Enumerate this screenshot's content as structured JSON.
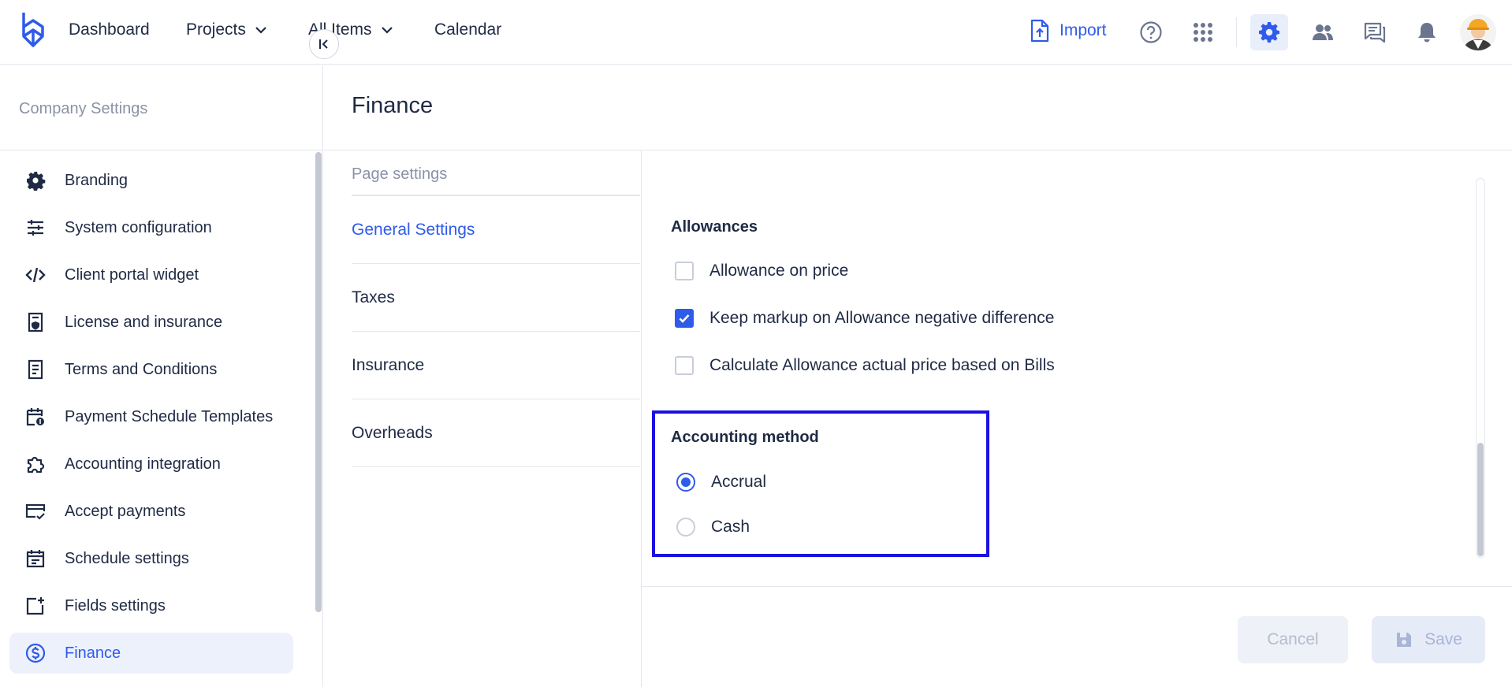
{
  "topbar": {
    "nav": [
      {
        "label": "Dashboard",
        "has_dropdown": false
      },
      {
        "label": "Projects",
        "has_dropdown": true
      },
      {
        "label": "All Items",
        "has_dropdown": true
      },
      {
        "label": "Calendar",
        "has_dropdown": false
      }
    ],
    "import_label": "Import",
    "icons": [
      "help-icon",
      "apps-grid-icon",
      "settings-icon",
      "users-icon",
      "chat-icon",
      "bell-icon"
    ],
    "active_icon": "settings-icon"
  },
  "sidebar": {
    "title": "Company Settings",
    "items": [
      {
        "label": "Branding",
        "icon": "gear-icon"
      },
      {
        "label": "System configuration",
        "icon": "sliders-icon"
      },
      {
        "label": "Client portal widget",
        "icon": "code-icon"
      },
      {
        "label": "License and insurance",
        "icon": "license-icon"
      },
      {
        "label": "Terms and Conditions",
        "icon": "document-icon"
      },
      {
        "label": "Payment Schedule Templates",
        "icon": "calendar-money-icon"
      },
      {
        "label": "Accounting integration",
        "icon": "puzzle-icon"
      },
      {
        "label": "Accept payments",
        "icon": "card-check-icon"
      },
      {
        "label": "Schedule settings",
        "icon": "calendar-icon"
      },
      {
        "label": "Fields settings",
        "icon": "add-field-icon"
      },
      {
        "label": "Finance",
        "icon": "dollar-circle-icon",
        "active": true
      }
    ]
  },
  "page": {
    "title": "Finance"
  },
  "subnav": {
    "heading": "Page settings",
    "items": [
      {
        "label": "General Settings",
        "active": true
      },
      {
        "label": "Taxes"
      },
      {
        "label": "Insurance"
      },
      {
        "label": "Overheads"
      }
    ]
  },
  "content": {
    "allowances_title": "Allowances",
    "checkboxes": [
      {
        "label": "Allowance on price",
        "checked": false
      },
      {
        "label": "Keep markup on Allowance negative difference",
        "checked": true
      },
      {
        "label": "Calculate Allowance actual price based on Bills",
        "checked": false
      }
    ],
    "accounting_title": "Accounting method",
    "radios": [
      {
        "label": "Accrual",
        "checked": true
      },
      {
        "label": "Cash",
        "checked": false
      }
    ]
  },
  "footer": {
    "cancel_label": "Cancel",
    "save_label": "Save"
  },
  "colors": {
    "accent": "#2f5bea",
    "highlight": "#1a10e0",
    "text": "#1f2a44",
    "muted": "#8a93a6"
  }
}
